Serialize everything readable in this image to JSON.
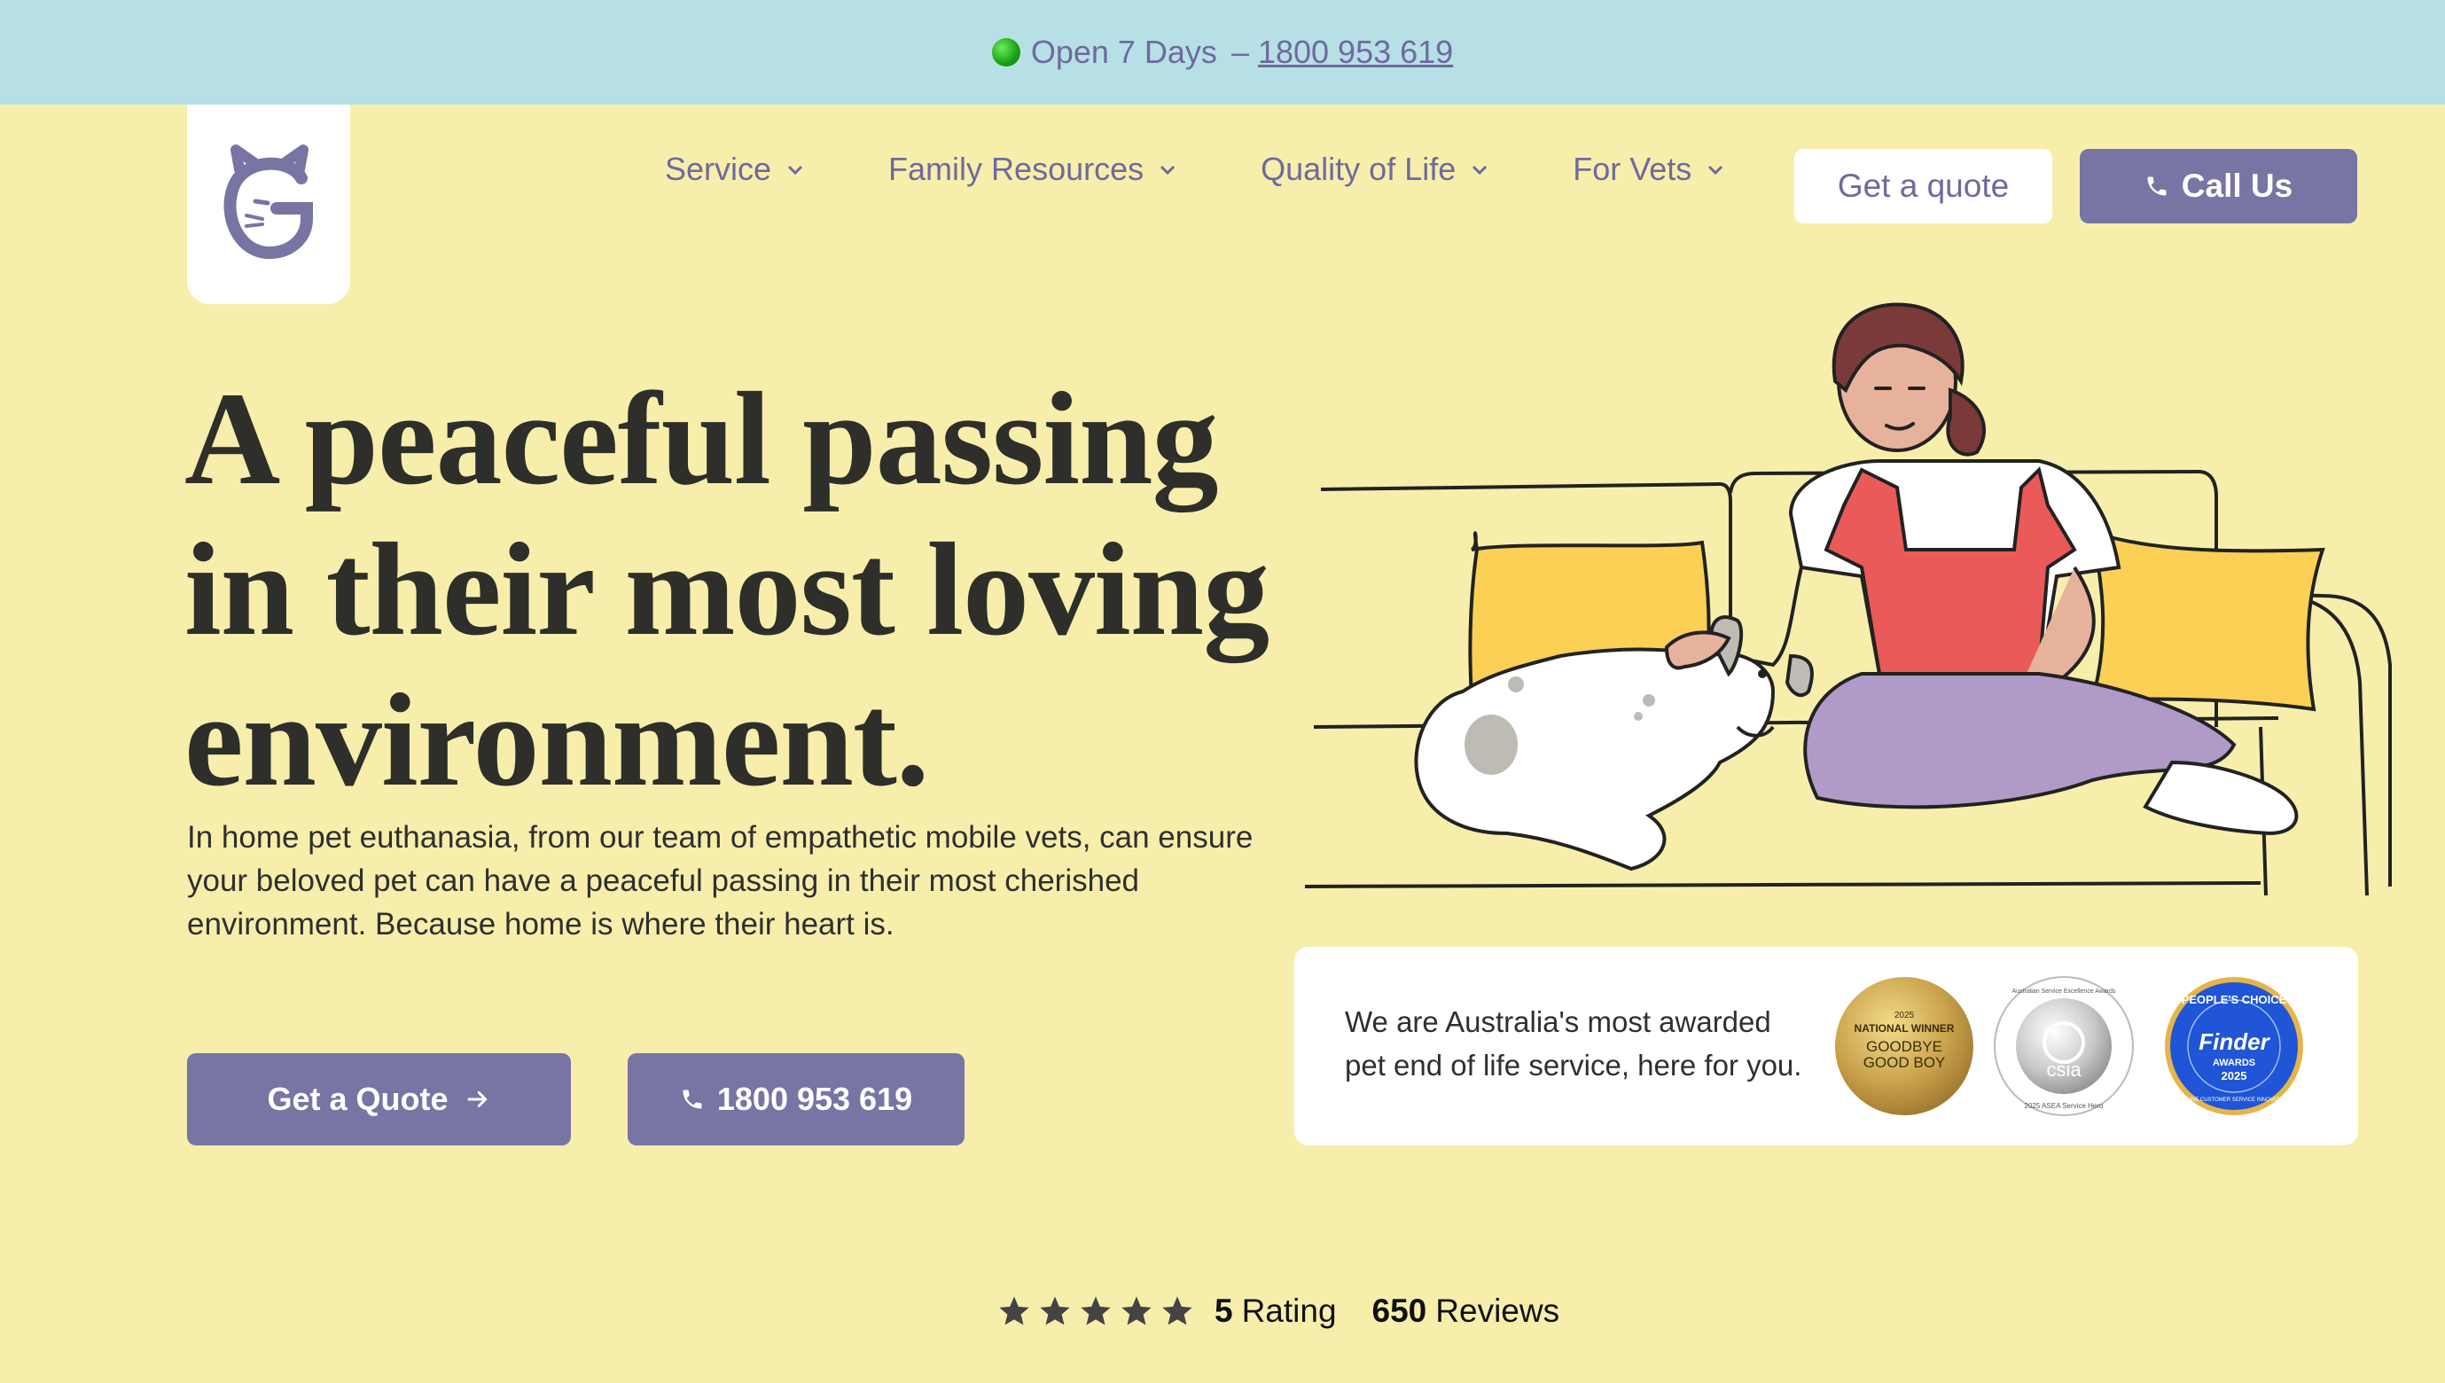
{
  "topbar": {
    "open": "Open 7 Days",
    "separator": "–",
    "phone": "1800 953 619"
  },
  "nav": {
    "items": [
      {
        "label": "Service"
      },
      {
        "label": "Family Resources"
      },
      {
        "label": "Quality of Life"
      },
      {
        "label": "For Vets"
      }
    ],
    "quote_label": "Get a quote",
    "call_label": "Call Us"
  },
  "hero": {
    "title_line1": "A peaceful passing",
    "title_line2": "in their most loving",
    "title_line3": "environment.",
    "body": "In home pet euthanasia, from our team of empathetic mobile vets, can ensure your beloved pet can have a peaceful passing in their most cherished environment. Because home is where their heart is.",
    "quote_button": "Get a Quote",
    "phone_button": "1800 953 619"
  },
  "awards": {
    "text": "We are Australia's most awarded pet end of life service, here for you.",
    "badge1": {
      "year": "2025",
      "line1": "NATIONAL WINNER",
      "line2": "GOODBYE",
      "line3": "GOOD BOY"
    },
    "badge2": {
      "name": "csia",
      "ring": "Australian Service Excellence Awards",
      "bottom": "2025 ASEA Service Hero"
    },
    "badge3": {
      "top": "PEOPLE'S CHOICE",
      "brand": "Finder",
      "sub": "AWARDS",
      "year": "2025",
      "ring": "ONLINE CUSTOMER SERVICE INNOVATION"
    }
  },
  "rating": {
    "score": "5",
    "score_label": "Rating",
    "reviews": "650",
    "reviews_label": "Reviews",
    "stars": 5
  },
  "colors": {
    "accent": "#7874a4",
    "topbar": "#b7e0e6",
    "background": "#f7eeac"
  }
}
